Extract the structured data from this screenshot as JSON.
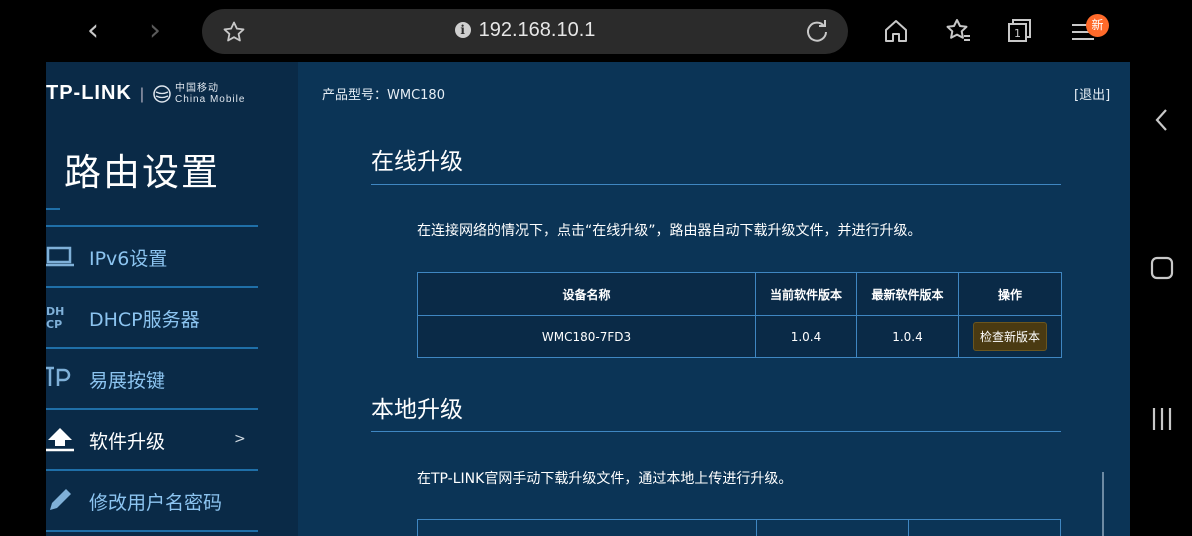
{
  "browser": {
    "url": "192.168.10.1",
    "badge": "新",
    "icons": [
      "back-icon",
      "forward-icon",
      "info-icon",
      "bookmark-star-icon",
      "reload-icon",
      "home-icon",
      "bookmarks-icon",
      "tabs-icon",
      "menu-icon"
    ],
    "tab_count": "1"
  },
  "header": {
    "brand": "TP-LINK",
    "partner_cn": "中国移动",
    "partner_en": "China Mobile",
    "model": "产品型号：WMC180",
    "logout": "[退出]"
  },
  "sidebar": {
    "title": "路由设置",
    "items": [
      {
        "label": "IPv6设置",
        "icon": "monitor-icon"
      },
      {
        "label": "DHCP服务器",
        "icon": "dhcp-icon"
      },
      {
        "label": "易展按键",
        "icon": "tp-icon"
      },
      {
        "label": "软件升级",
        "icon": "upload-icon",
        "arrow": ">",
        "active": true
      },
      {
        "label": "修改用户名密码",
        "icon": "pencil-icon"
      }
    ]
  },
  "online": {
    "title": "在线升级",
    "desc": "在连接网络的情况下，点击“在线升级”，路由器自动下载升级文件，并进行升级。",
    "headers": [
      "设备名称",
      "当前软件版本",
      "最新软件版本",
      "操作"
    ],
    "row": {
      "device": "WMC180-7FD3",
      "current": "1.0.4",
      "latest": "1.0.4",
      "action": "检查新版本"
    }
  },
  "local": {
    "title": "本地升级",
    "desc": "在TP-LINK官网手动下载升级文件，通过本地上传进行升级。"
  },
  "colors": {
    "page_bg": "#0b3456",
    "sidebar_bg": "#0a2a47",
    "accent": "#3f86c1",
    "badge": "#ff6a2a"
  }
}
